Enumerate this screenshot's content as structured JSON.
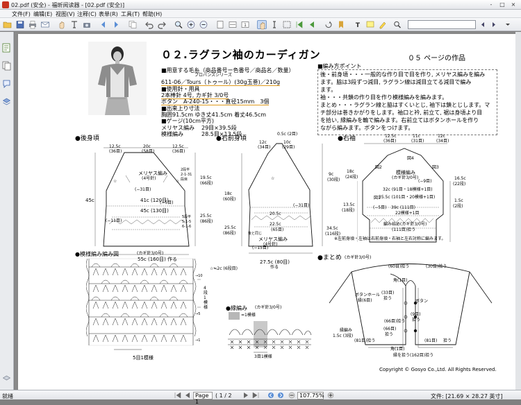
{
  "window": {
    "title": "02.pdf (安全) - 福昕阅读器 - [02.pdf (安全)]",
    "controls": [
      "-",
      "□",
      "×"
    ]
  },
  "menu": [
    {
      "label": "文件(F)"
    },
    {
      "label": "编辑(E)"
    },
    {
      "label": "视图(V)"
    },
    {
      "label": "注释(C)"
    },
    {
      "label": "表单(R)"
    },
    {
      "label": "工具(T)"
    },
    {
      "label": "帮助(H)"
    }
  ],
  "toolbar": {
    "search_placeholder": ""
  },
  "document": {
    "title": "０２.ラグラン袖のカーディガン",
    "page_ref": "０５ ページの作品",
    "materials": {
      "yarn_heading": "■用意する毛糸（商品番号ー色番号／商品名／数量）",
      "yarn_brand": "プロバンスシリーズ",
      "yarn_line": "611-06／Tours（トゥール）(30g玉巻)／210g",
      "needles_heading": "■使用針・用具",
      "needles_line": "2本棒針 4号, カギ針 3/0号",
      "buttons_line": "ボタン　A-240-15・・・直径15mm　3個",
      "size_heading": "■出来上り寸法",
      "size_line": "胸囲91.5cm ゆき丈41.5cm 着丈46.5cm",
      "gauge_heading": "■ゲージ(10cm平方)",
      "gauge_1_label": "メリヤス編み",
      "gauge_1_value": "29目×39.5段",
      "gauge_2_label": "模様編み",
      "gauge_2_value": "28.5目×13.5段"
    },
    "points": {
      "heading": "■編み方ポイント",
      "lines": [
        "後・前身頃・・・一般的な作り目で目を作り, メリヤス編みを編み",
        "ます。脇は3段ずつ減目, ラグラン線は減目立てる減目で編み",
        "ます。",
        "袖・・・共鎖の作り目を作り模様編みを編みます。",
        "まとめ・・・ラグラン線と脇はすくいとじ, 袖下は鎖とじします。マ",
        "チ部分は巻きかがりをします。袖口と衿, 前立て, 裾は身頃より目",
        "を拾い, 縁編みを輪で編みます。右前立てはボタンホールを作り",
        "ながら編みます。ボタンをつけます。"
      ]
    },
    "back": {
      "heading": "●後身頃",
      "top_left": "12.5c",
      "top_left_s": "(36目)",
      "top_mid": "20c",
      "top_mid_s": "(58目)",
      "top_right": "12.5c",
      "top_right_s": "(36目)",
      "center": "メリヤス編み",
      "center_s": "(4号針)",
      "row1": "41c (120目)",
      "row2": "45c (130目)",
      "minus31": "(−31目)",
      "minus5": "(−5目)",
      "left_h": "45c",
      "left_dec": "(−11目)",
      "rag_h": "19.5c",
      "rag_h_s": "(66段)",
      "side_h": "25.5c",
      "side_h_s": "(86段)",
      "bottom": "55c (160目) 作る",
      "dec_a": "2段平",
      "dec_b": "2-1-31",
      "dec_c": "段目",
      "dec_d": "5段平",
      "dec_e": "5-1-5",
      "dec_f": "6-1-6"
    },
    "front": {
      "heading": "●右前身頃",
      "top": "0.5c (2目)",
      "w1": "12c",
      "w1_s": "(34目)",
      "w2": "10c",
      "w2_s": "(29目)",
      "h1": "18c",
      "h1_s": "(60段)",
      "h2": "25.5c",
      "h2_s": "(86段)",
      "h3": "9c",
      "h3_s": "(30段)",
      "h4": "34.5c",
      "h4_s": "(116段)",
      "r1": "20.5c",
      "r2": "22.5c",
      "r3": "(65目)",
      "center": "メリヤス編み",
      "center_s": "(4号針)",
      "dec_15": "(−15目)",
      "dec_31": "(−31目)",
      "bottom": "27.5c (80目)",
      "bottom_s": "作る",
      "approx": "☆≒2c (6段目)",
      "side_s": "後と同じ"
    },
    "sleeve": {
      "heading": "●右袖",
      "t1": "12.5c",
      "t1_s": "(36目)",
      "t2": "11c",
      "t2_s": "(31目)",
      "t3": "12c",
      "t3_s": "(34目)",
      "zu2": "図2",
      "zu3": "図3",
      "zu4": "図4",
      "zu1": "図1",
      "center": "模様編み",
      "center_s": "(カギ針3/0号)",
      "l1": "18c",
      "l1_s": "(24段)",
      "l2": "13.5c",
      "l2_s": "(18段)",
      "r1": "16.5c",
      "r1_s": "(22段)",
      "r2": "1.5c",
      "r2_s": "(2段)",
      "row1": "32c (91目・18模様+1目)",
      "row2": "35.5c (101目・20模様+1目)",
      "row3": "39c (111目)",
      "row4": "22模様+1目",
      "minus9": "(−9目)",
      "minus5": "(−5目)",
      "bottom": "編み始め(カギ針3/0号)",
      "bottom_s": "(111目)拾う",
      "note": "※左前身頃・左袖は右前身頃・右袖と左右対称に編みます。"
    },
    "chart": {
      "heading": "●模様編み編み図",
      "heading_s": "(カギ針3/0号)",
      "legend": "=1模様",
      "rep": "4段1模様",
      "rows": [
        "→10",
        "→5",
        "→1"
      ],
      "bottom": "5目1模様"
    },
    "edging": {
      "heading": "●縁編み",
      "heading_s": "(カギ針3/0号)",
      "bottom": "3目1模様"
    },
    "finish": {
      "heading": "●まとめ",
      "heading_s": "(カギ針3/0号)",
      "a": "(60目)拾う",
      "b": "(30目)拾う",
      "c": "角(1目)",
      "d": "(33目)",
      "d2": "拾う",
      "e": "ボタンホール",
      "e2": "縁(6目)",
      "f": "ボタン",
      "g": "(9目)",
      "g2": "拾う",
      "h": "縁編み",
      "h2": "1.5c (3段)",
      "i": "(66目)",
      "i2": "拾う",
      "j": "(81目)",
      "j2": "拾う",
      "k": "角(1目)",
      "l": "(81目)拾う",
      "m": "(66目)拾う",
      "n": "縁を拾う(162目)拾う"
    },
    "copyright": "Copyright © Gosyo Co.,Ltd. All Rights Reserved."
  },
  "status": {
    "left": "就绪",
    "page_label": "Page 1",
    "page_of": "( 1 / 2",
    "zoom": "107.75%",
    "right": "文件: [21.69 × 28.27 英寸]"
  },
  "colors": {
    "accent_underline": "#e09a1c",
    "pdf_red": "#c8321e"
  }
}
